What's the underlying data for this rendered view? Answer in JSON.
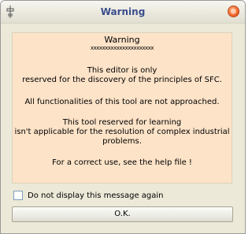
{
  "window": {
    "title": "Warning",
    "system_icon": "ladder-diagram-icon",
    "close_icon": "close-icon",
    "close_color": "#f36a2a"
  },
  "message": {
    "heading": "Warning",
    "rule": "xxxxxxxxxxxxxxxxxxxxxx",
    "lines": [
      "This editor is only",
      "reserved for the discovery of the principles of SFC.",
      "All functionalities of this tool are not approached.",
      "This tool reserved for learning",
      "isn't applicable for the resolution of complex industrial",
      "problems.",
      "For a correct use, see the help file !"
    ],
    "background": "#fde3c8"
  },
  "checkbox": {
    "label": "Do not display  this message again",
    "checked": false
  },
  "ok_button": {
    "label": "O.K."
  }
}
